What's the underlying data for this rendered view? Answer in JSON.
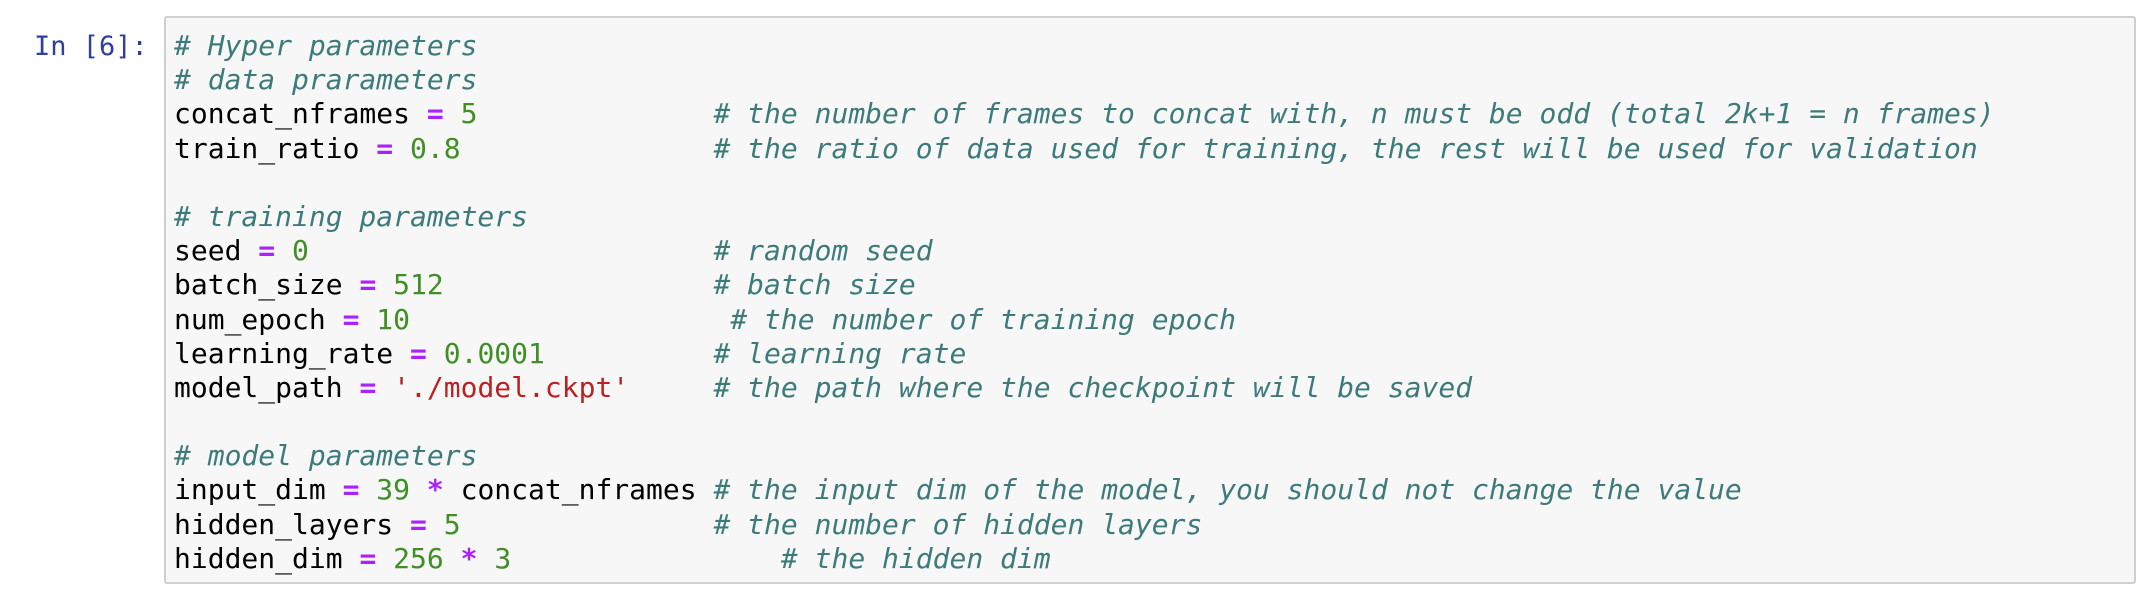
{
  "cell": {
    "prompt": "In [6]:",
    "colors": {
      "comment": "#3d7b7b",
      "operator": "#aa22ff",
      "number": "#3f8f25",
      "string": "#ba2121",
      "prompt": "#303f9f",
      "background": "#f7f7f7",
      "border": "#cfcfcf"
    },
    "lines": [
      [
        {
          "t": "comment",
          "v": "# Hyper parameters"
        }
      ],
      [
        {
          "t": "comment",
          "v": "# data prarameters"
        }
      ],
      [
        {
          "t": "name",
          "v": "concat_nframes"
        },
        {
          "t": "space",
          "v": " "
        },
        {
          "t": "op",
          "v": "="
        },
        {
          "t": "space",
          "v": " "
        },
        {
          "t": "num",
          "v": "5"
        },
        {
          "t": "space",
          "v": "              "
        },
        {
          "t": "comment",
          "v": "# the number of frames to concat with, n must be odd (total 2k+1 = n frames)"
        }
      ],
      [
        {
          "t": "name",
          "v": "train_ratio"
        },
        {
          "t": "space",
          "v": " "
        },
        {
          "t": "op",
          "v": "="
        },
        {
          "t": "space",
          "v": " "
        },
        {
          "t": "num",
          "v": "0.8"
        },
        {
          "t": "space",
          "v": "               "
        },
        {
          "t": "comment",
          "v": "# the ratio of data used for training, the rest will be used for validation"
        }
      ],
      [],
      [
        {
          "t": "comment",
          "v": "# training parameters"
        }
      ],
      [
        {
          "t": "name",
          "v": "seed"
        },
        {
          "t": "space",
          "v": " "
        },
        {
          "t": "op",
          "v": "="
        },
        {
          "t": "space",
          "v": " "
        },
        {
          "t": "num",
          "v": "0"
        },
        {
          "t": "space",
          "v": "                        "
        },
        {
          "t": "comment",
          "v": "# random seed"
        }
      ],
      [
        {
          "t": "name",
          "v": "batch_size"
        },
        {
          "t": "space",
          "v": " "
        },
        {
          "t": "op",
          "v": "="
        },
        {
          "t": "space",
          "v": " "
        },
        {
          "t": "num",
          "v": "512"
        },
        {
          "t": "space",
          "v": "                "
        },
        {
          "t": "comment",
          "v": "# batch size"
        }
      ],
      [
        {
          "t": "name",
          "v": "num_epoch"
        },
        {
          "t": "space",
          "v": " "
        },
        {
          "t": "op",
          "v": "="
        },
        {
          "t": "space",
          "v": " "
        },
        {
          "t": "num",
          "v": "10"
        },
        {
          "t": "space",
          "v": "                   "
        },
        {
          "t": "comment",
          "v": "# the number of training epoch"
        }
      ],
      [
        {
          "t": "name",
          "v": "learning_rate"
        },
        {
          "t": "space",
          "v": " "
        },
        {
          "t": "op",
          "v": "="
        },
        {
          "t": "space",
          "v": " "
        },
        {
          "t": "num",
          "v": "0.0001"
        },
        {
          "t": "space",
          "v": "          "
        },
        {
          "t": "comment",
          "v": "# learning rate"
        }
      ],
      [
        {
          "t": "name",
          "v": "model_path"
        },
        {
          "t": "space",
          "v": " "
        },
        {
          "t": "op",
          "v": "="
        },
        {
          "t": "space",
          "v": " "
        },
        {
          "t": "str",
          "v": "'./model.ckpt'"
        },
        {
          "t": "space",
          "v": "     "
        },
        {
          "t": "comment",
          "v": "# the path where the checkpoint will be saved"
        }
      ],
      [],
      [
        {
          "t": "comment",
          "v": "# model parameters"
        }
      ],
      [
        {
          "t": "name",
          "v": "input_dim"
        },
        {
          "t": "space",
          "v": " "
        },
        {
          "t": "op",
          "v": "="
        },
        {
          "t": "space",
          "v": " "
        },
        {
          "t": "num",
          "v": "39"
        },
        {
          "t": "space",
          "v": " "
        },
        {
          "t": "op",
          "v": "*"
        },
        {
          "t": "space",
          "v": " "
        },
        {
          "t": "name",
          "v": "concat_nframes"
        },
        {
          "t": "space",
          "v": " "
        },
        {
          "t": "comment",
          "v": "# the input dim of the model, you should not change the value"
        }
      ],
      [
        {
          "t": "name",
          "v": "hidden_layers"
        },
        {
          "t": "space",
          "v": " "
        },
        {
          "t": "op",
          "v": "="
        },
        {
          "t": "space",
          "v": " "
        },
        {
          "t": "num",
          "v": "5"
        },
        {
          "t": "space",
          "v": "               "
        },
        {
          "t": "comment",
          "v": "# the number of hidden layers"
        }
      ],
      [
        {
          "t": "name",
          "v": "hidden_dim"
        },
        {
          "t": "space",
          "v": " "
        },
        {
          "t": "op",
          "v": "="
        },
        {
          "t": "space",
          "v": " "
        },
        {
          "t": "num",
          "v": "256"
        },
        {
          "t": "space",
          "v": " "
        },
        {
          "t": "op",
          "v": "*"
        },
        {
          "t": "space",
          "v": " "
        },
        {
          "t": "num",
          "v": "3"
        },
        {
          "t": "space",
          "v": "                "
        },
        {
          "t": "comment",
          "v": "# the hidden dim"
        }
      ]
    ]
  }
}
